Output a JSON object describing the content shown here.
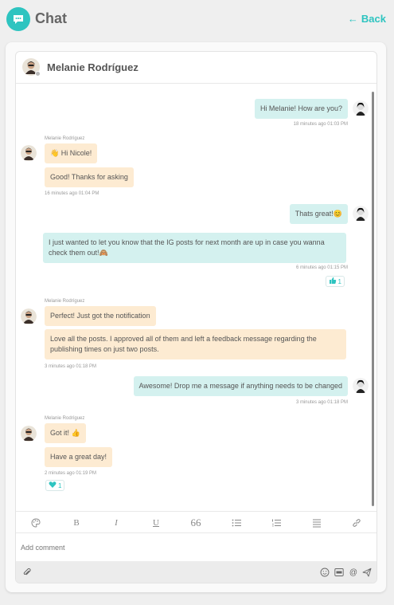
{
  "app": {
    "title": "Chat",
    "back_label": "Back",
    "accent": "#2ec4c0"
  },
  "contact": {
    "name": "Melanie Rodríguez"
  },
  "messages": [
    {
      "from": "me",
      "text": "Hi Melanie! How are you?",
      "meta": "18 minutes ago 01:03 PM"
    },
    {
      "from": "them",
      "sender": "Melanie Rodríguez",
      "text": "👋 Hi Nicole!"
    },
    {
      "from": "them",
      "text": "Good! Thanks for asking",
      "meta": "16 minutes ago 01:04 PM"
    },
    {
      "from": "me",
      "text": "Thats great!😊"
    },
    {
      "from": "me",
      "text": "I just wanted to let you know that the IG posts for next month are up in case you wanna check them out!🙈",
      "meta": "6 minutes ago 01:15 PM",
      "reaction": {
        "icon": "thumbs-up-icon",
        "count": "1"
      }
    },
    {
      "from": "them",
      "sender": "Melanie Rodríguez",
      "text": "Perfect! Just got the notification"
    },
    {
      "from": "them",
      "text": "Love all the posts. I approved all of them and left a feedback message regarding the publishing times on just two posts.",
      "meta": "3 minutes ago 01:18 PM"
    },
    {
      "from": "me",
      "text": "Awesome! Drop me a message if anything needs to be changed",
      "meta": "3 minutes ago 01:18 PM"
    },
    {
      "from": "them",
      "sender": "Melanie Rodríguez",
      "text": "Got it! 👍"
    },
    {
      "from": "them",
      "text": "Have a great day!",
      "meta": "2 minutes ago 01:19 PM",
      "reaction": {
        "icon": "heart-icon",
        "count": "1"
      }
    }
  ],
  "toolbar": [
    "palette-icon",
    "bold-icon",
    "italic-icon",
    "underline-icon",
    "quote-icon",
    "bullet-list-icon",
    "numbered-list-icon",
    "align-icon",
    "link-icon"
  ],
  "composer": {
    "placeholder": "Add comment"
  },
  "bottom_icons": [
    "attach-icon",
    "emoji-icon",
    "gif-icon",
    "mention-icon",
    "send-icon"
  ]
}
